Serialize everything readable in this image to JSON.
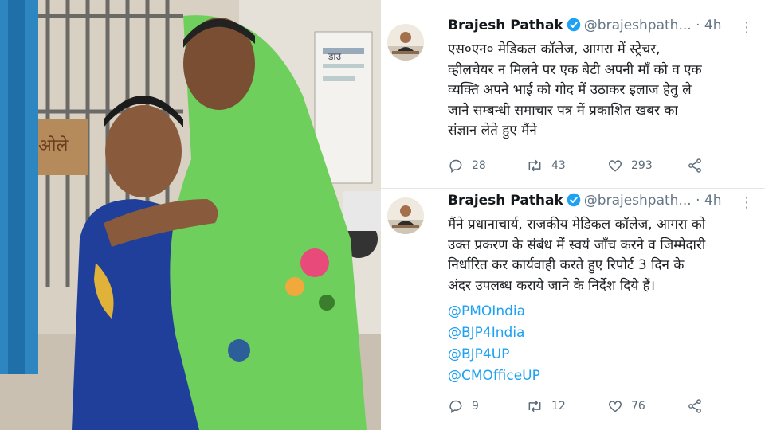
{
  "photo": {
    "wall_text": "ओले",
    "notice_text": "डाउ",
    "colors": {
      "saree_green": "#6fcf5c",
      "blouse_blue": "#1f3f9a",
      "door_blue": "#2e86c1"
    }
  },
  "tweets": [
    {
      "author_name": "Brajesh Pathak",
      "handle": "@brajeshpath...",
      "time": "4h",
      "text_lines": [
        "एस०एन० मेडिकल कॉलेज, आगरा में स्ट्रेचर,",
        "व्हीलचेयर न मिलने पर एक बेटी अपनी माँ को व एक",
        "व्यक्ति अपने भाई को गोद में उठाकर इलाज हेतु ले",
        "जाने सम्बन्धी समाचार पत्र में प्रकाशित खबर का",
        "संज्ञान लेते हुए मैंने"
      ],
      "mentions": [],
      "replies": "28",
      "retweets": "43",
      "likes": "293"
    },
    {
      "author_name": "Brajesh Pathak",
      "handle": "@brajeshpath...",
      "time": "4h",
      "text_lines": [
        "मैंने प्रधानाचार्य, राजकीय मेडिकल कॉलेज, आगरा को",
        "उक्त प्रकरण के संबंध में स्वयं जाँच करने व जिम्मेदारी",
        "निर्धारित कर कार्यवाही करते हुए रिपोर्ट 3 दिन के",
        "अंदर उपलब्ध कराये जाने के निर्देश दिये हैं।"
      ],
      "mentions": [
        "@PMOIndia",
        "@BJP4India",
        "@BJP4UP",
        "@CMOfficeUP"
      ],
      "replies": "9",
      "retweets": "12",
      "likes": "76"
    }
  ],
  "icons": {
    "verified": "verified-badge-icon",
    "more": "more-vertical-icon",
    "reply": "reply-icon",
    "retweet": "retweet-icon",
    "like": "heart-icon",
    "share": "share-icon"
  },
  "colors": {
    "link": "#1da1f2",
    "muted": "#657786",
    "verified": "#1da1f2"
  },
  "glyphs": {
    "more": "⋮",
    "dot": "·"
  }
}
